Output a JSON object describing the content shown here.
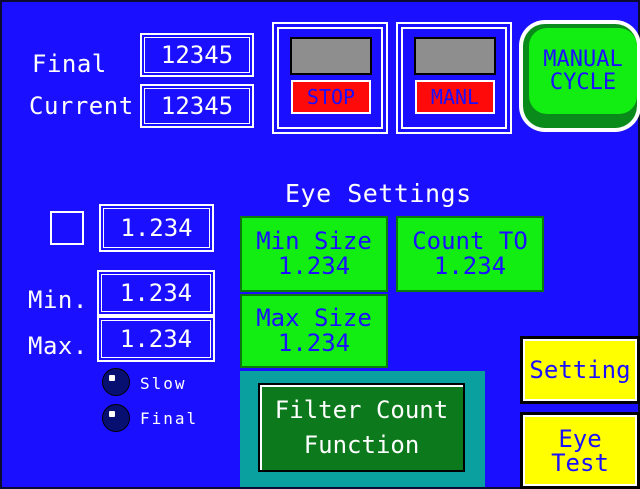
{
  "counts": {
    "final_label": "Final",
    "final_value": "12345",
    "current_label": "Current",
    "current_value": "12345"
  },
  "lamps": {
    "stop_label": "STOP",
    "manl_label": "MANL"
  },
  "manual_cycle": {
    "line1": "MANUAL",
    "line2": "CYCLE"
  },
  "eye_settings": {
    "title": "Eye Settings",
    "min_size_label": "Min Size",
    "min_size_value": "1.234",
    "count_to_label": "Count TO",
    "count_to_value": "1.234",
    "max_size_label": "Max Size",
    "max_size_value": "1.234"
  },
  "left_values": {
    "top_value": "1.234",
    "min_label": "Min.",
    "min_value": "1.234",
    "max_label": "Max.",
    "max_value": "1.234"
  },
  "indicators": {
    "slow_label": "Slow",
    "final_label": "Final"
  },
  "filter_button": {
    "line1": "Filter Count",
    "line2": "Function"
  },
  "side_buttons": {
    "setting_label": "Setting",
    "eye_test_line1": "Eye",
    "eye_test_line2": "Test"
  },
  "colors": {
    "background": "#1a10ff",
    "button_green": "#12ee12",
    "button_yellow": "#ffff00",
    "lamp_red": "#ff0a0a",
    "filter_dark_green": "#0c7a1c"
  }
}
